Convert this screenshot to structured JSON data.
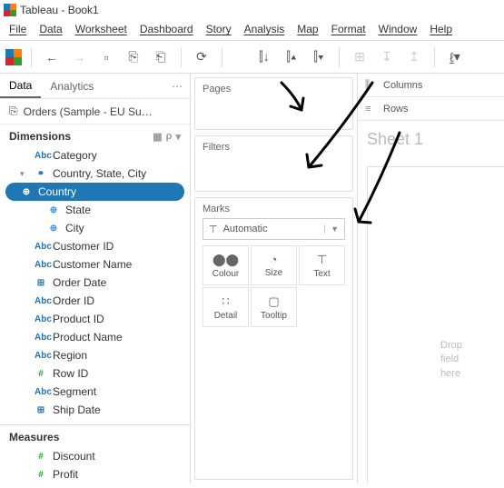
{
  "window": {
    "title": "Tableau - Book1"
  },
  "menu": [
    "File",
    "Data",
    "Worksheet",
    "Dashboard",
    "Story",
    "Analysis",
    "Map",
    "Format",
    "Window",
    "Help"
  ],
  "datasource": "Orders (Sample - EU Su…",
  "tabs": {
    "data": "Data",
    "analytics": "Analytics"
  },
  "sections": {
    "dimensions": "Dimensions",
    "measures": "Measures"
  },
  "dims": [
    {
      "icon": "Abc",
      "label": "Category",
      "indent": 0
    },
    {
      "icon": "hier",
      "label": "Country, State, City",
      "indent": 0,
      "caret": "▾"
    },
    {
      "icon": "geo",
      "label": "Country",
      "indent": 2,
      "selected": true
    },
    {
      "icon": "geo",
      "label": "State",
      "indent": 2
    },
    {
      "icon": "geo",
      "label": "City",
      "indent": 2
    },
    {
      "icon": "Abc",
      "label": "Customer ID",
      "indent": 0
    },
    {
      "icon": "Abc",
      "label": "Customer Name",
      "indent": 0
    },
    {
      "icon": "date",
      "label": "Order Date",
      "indent": 0
    },
    {
      "icon": "Abc",
      "label": "Order ID",
      "indent": 0
    },
    {
      "icon": "Abc",
      "label": "Product ID",
      "indent": 0
    },
    {
      "icon": "Abc",
      "label": "Product Name",
      "indent": 0
    },
    {
      "icon": "Abc",
      "label": "Region",
      "indent": 0
    },
    {
      "icon": "num",
      "label": "Row ID",
      "indent": 0
    },
    {
      "icon": "Abc",
      "label": "Segment",
      "indent": 0
    },
    {
      "icon": "date",
      "label": "Ship Date",
      "indent": 0
    }
  ],
  "meas": [
    {
      "icon": "num",
      "label": "Discount"
    },
    {
      "icon": "num",
      "label": "Profit"
    }
  ],
  "shelves": {
    "pages": "Pages",
    "filters": "Filters",
    "marks": "Marks",
    "columns": "Columns",
    "rows": "Rows"
  },
  "marks": {
    "selector": "Automatic",
    "cells": [
      "Colour",
      "Size",
      "Text",
      "Detail",
      "Tooltip"
    ]
  },
  "sheet": {
    "title": "Sheet 1",
    "drop": "Drop field here"
  }
}
